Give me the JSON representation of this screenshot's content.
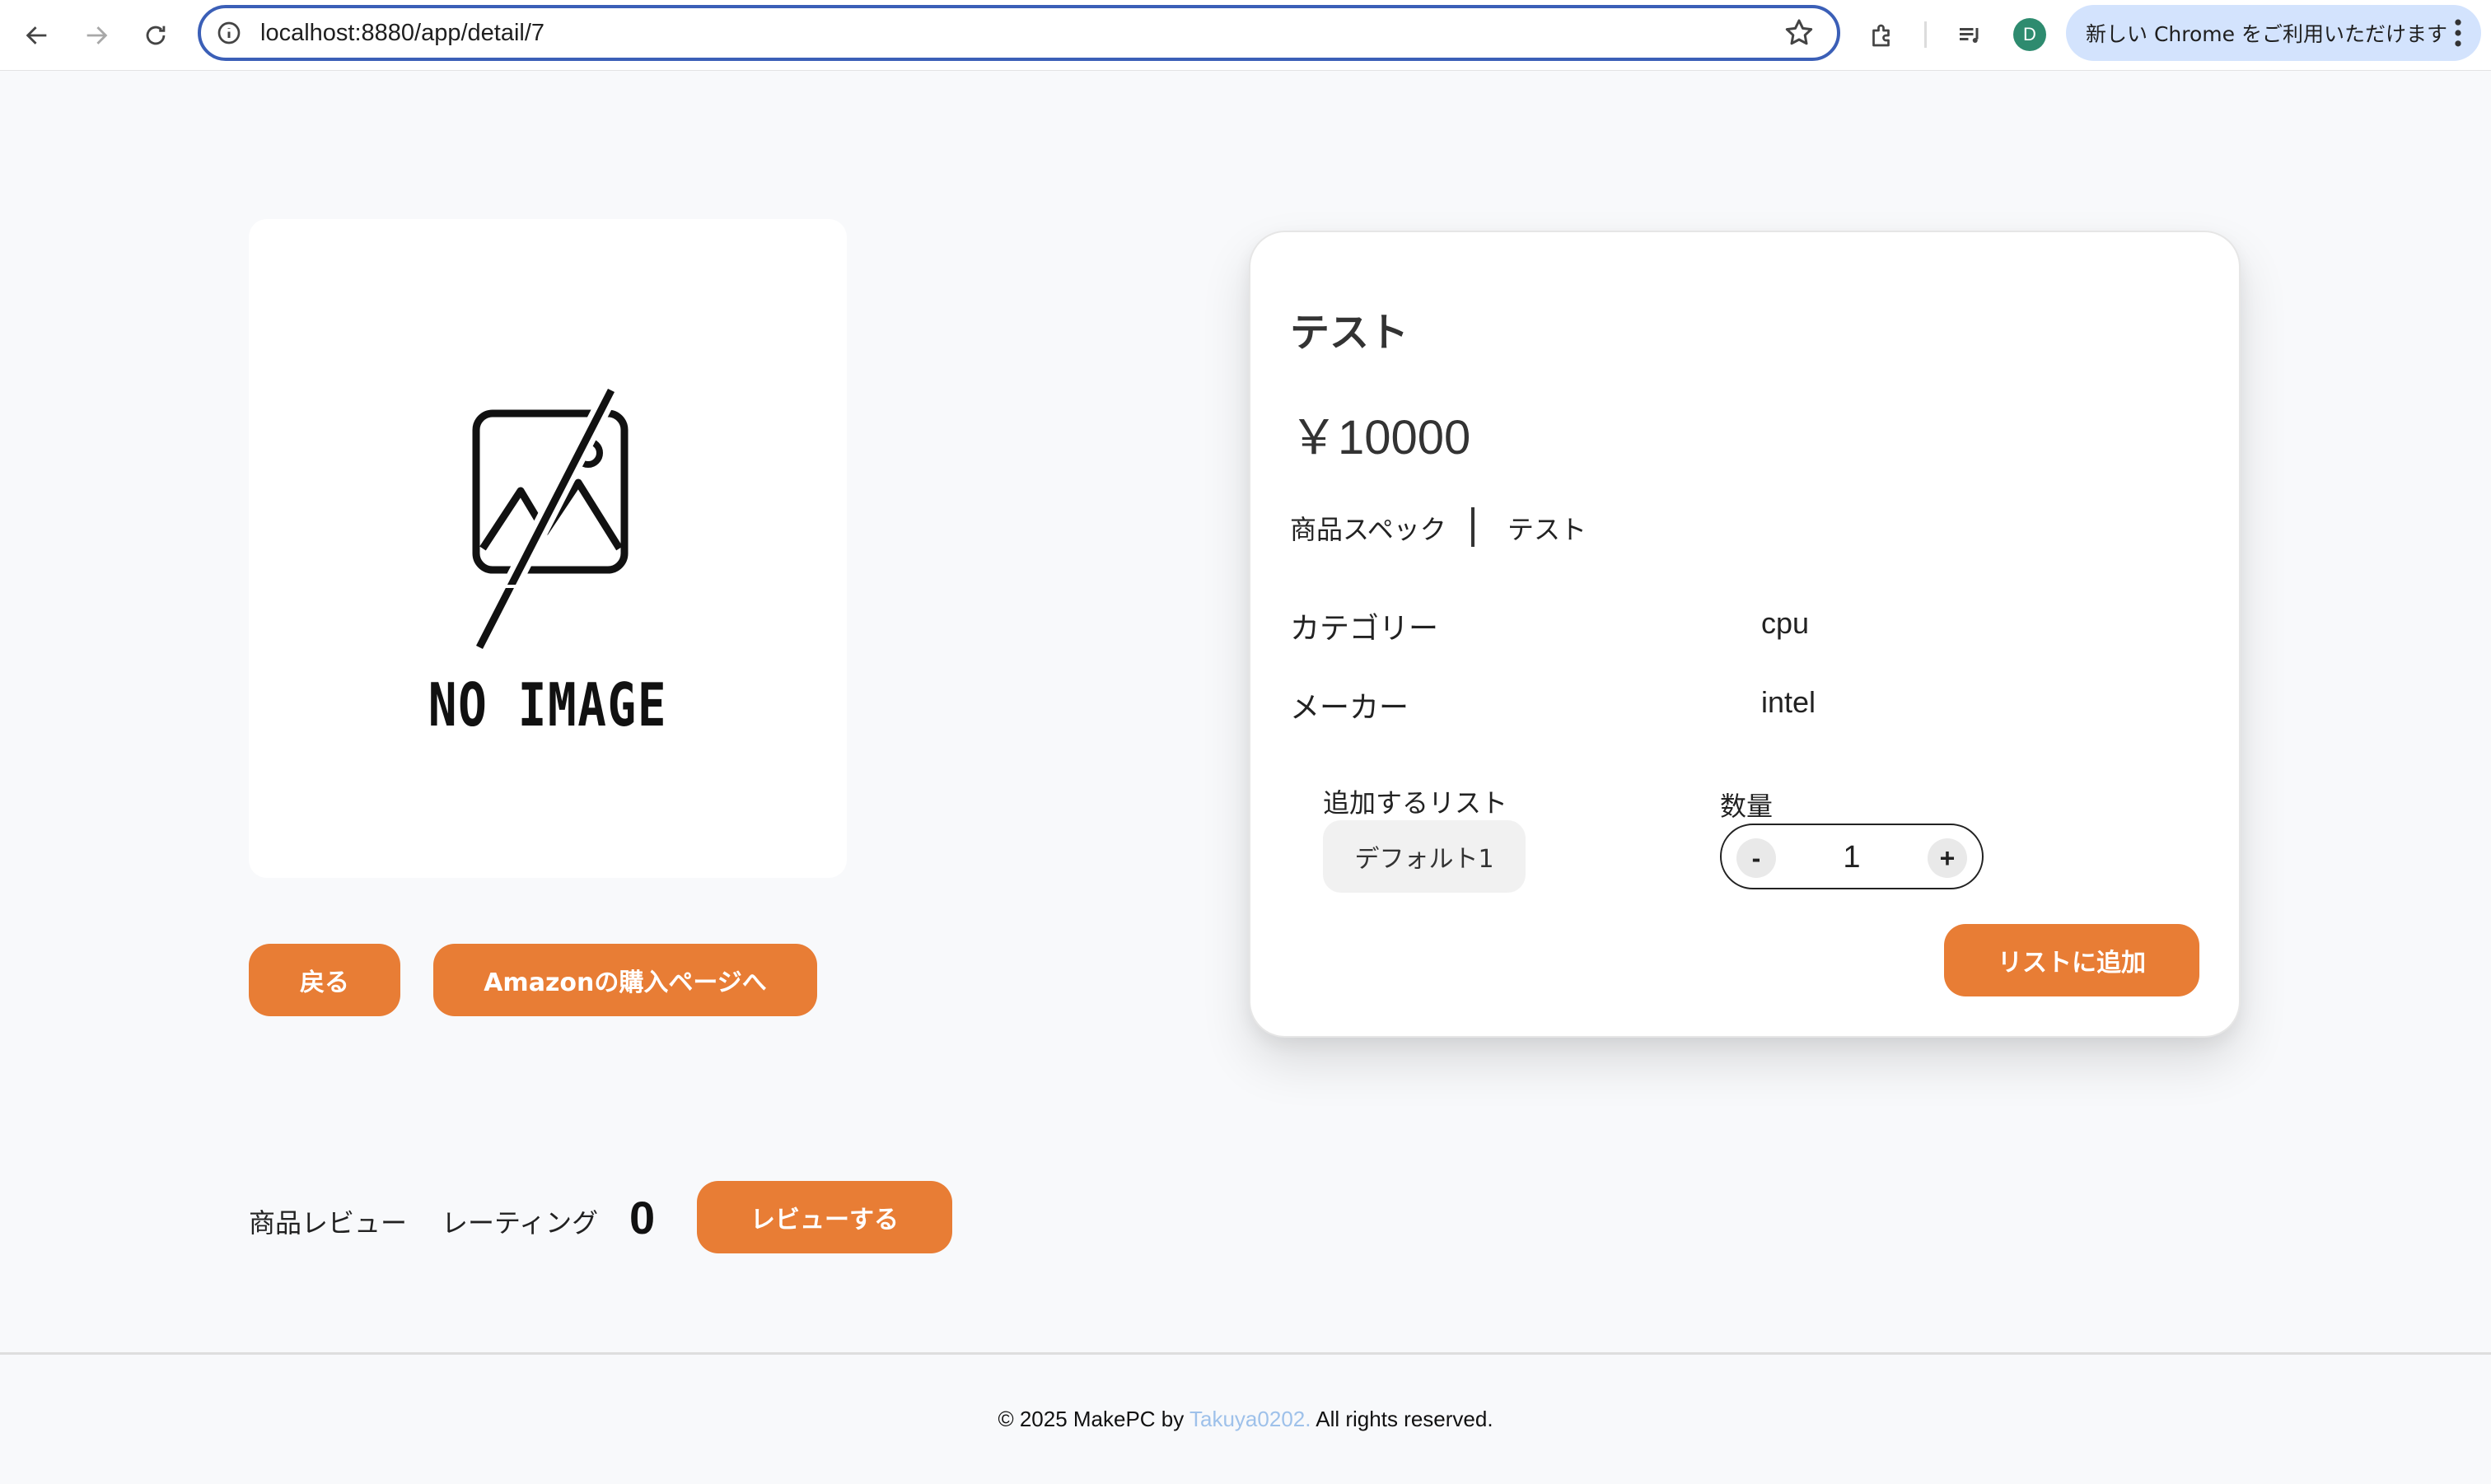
{
  "browser": {
    "url": "localhost:8880/app/detail/7",
    "profile_initial": "D",
    "update_label": "新しい Chrome をご利用いただけます"
  },
  "product": {
    "image_alt_text": "NO IMAGE",
    "back_label": "戻る",
    "amazon_label": "Amazonの購入ページへ",
    "name": "テスト",
    "price": "￥10000",
    "spec_label": "商品スペック",
    "spec_value": "テスト",
    "category_label": "カテゴリー",
    "category_value": "cpu",
    "maker_label": "メーカー",
    "maker_value": "intel"
  },
  "add_to_list": {
    "list_label": "追加するリスト",
    "selected_list": "デフォルト1",
    "quantity_label": "数量",
    "quantity": "1",
    "minus": "-",
    "plus": "+",
    "submit_label": "リストに追加"
  },
  "reviews": {
    "section_label": "商品レビュー",
    "rating_label": "レーティング",
    "rating_value": "0",
    "review_button": "レビューする"
  },
  "footer": {
    "prefix": "© 2025 MakePC by ",
    "author": "Takuya0202.",
    "suffix": " All rights reserved."
  },
  "colors": {
    "accent": "#e87d35",
    "background": "#f8f9fb",
    "link": "#9ec1ea"
  },
  "icons": [
    "back-arrow-icon",
    "forward-arrow-icon",
    "reload-icon",
    "site-info-icon",
    "star-icon",
    "extensions-icon",
    "media-controls-icon",
    "kebab-menu-icon"
  ]
}
